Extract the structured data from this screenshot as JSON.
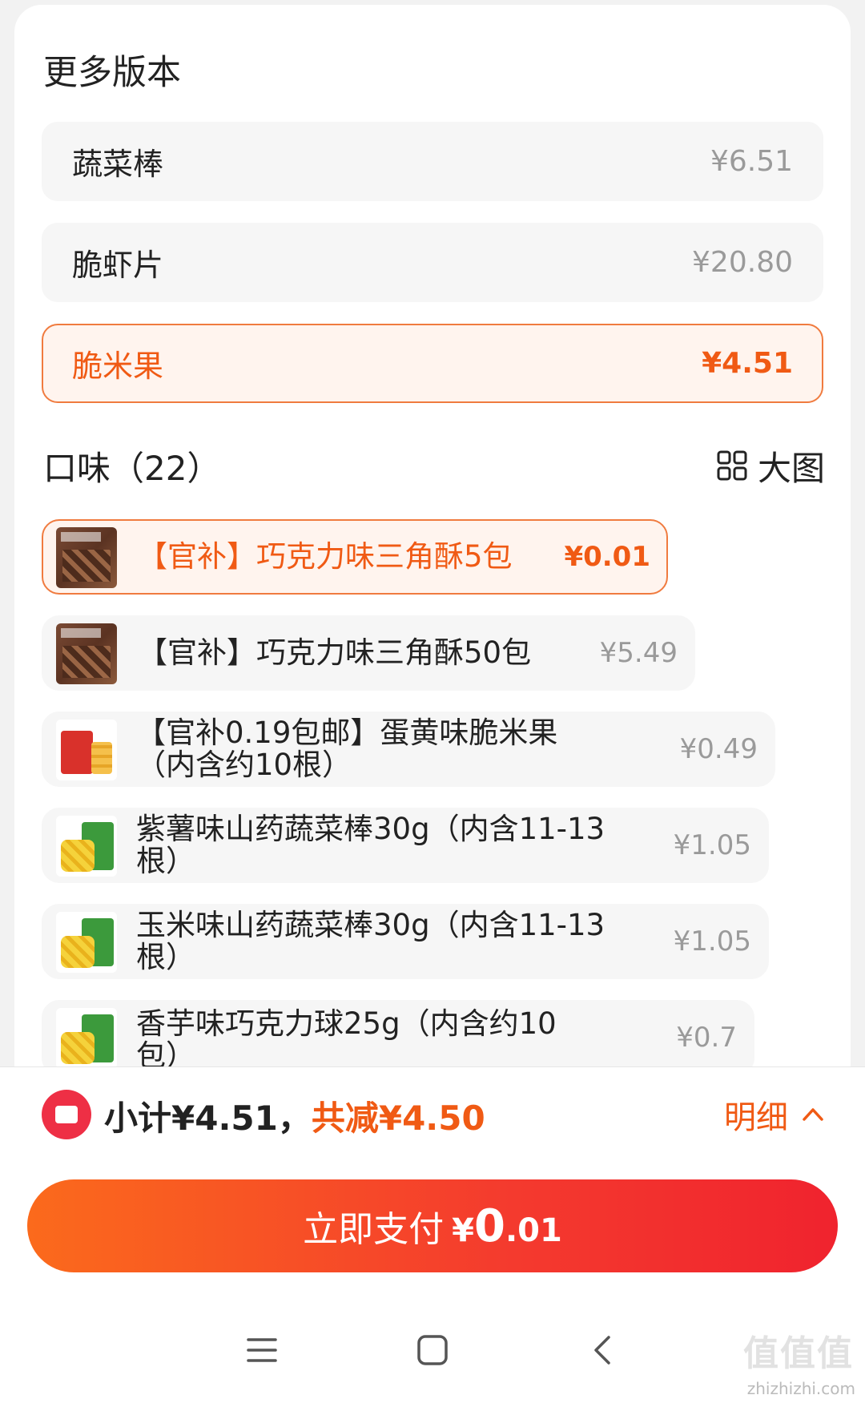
{
  "versions": {
    "title": "更多版本",
    "items": [
      {
        "name": "蔬菜棒",
        "price": "¥6.51"
      },
      {
        "name": "脆虾片",
        "price": "¥20.80"
      },
      {
        "name": "脆米果",
        "price": "¥4.51"
      }
    ]
  },
  "flavors": {
    "title": "口味（22）",
    "big_view_label": "大图",
    "items": [
      {
        "name": "【官补】巧克力味三角酥5包",
        "price": "¥0.01"
      },
      {
        "name": "【官补】巧克力味三角酥50包",
        "price": "¥5.49"
      },
      {
        "name": "【官补0.19包邮】蛋黄味脆米果（内含约10根）",
        "price": "¥0.49"
      },
      {
        "name": "紫薯味山药蔬菜棒30g（内含11-13根）",
        "price": "¥1.05"
      },
      {
        "name": "玉米味山药蔬菜棒30g（内含11-13根）",
        "price": "¥1.05"
      },
      {
        "name": "香芋味巧克力球25g（内含约10包）",
        "price": "¥0.7"
      }
    ]
  },
  "summary": {
    "subtotal": "小计¥4.51，",
    "reduction": "共减¥4.50",
    "detail_label": "明细"
  },
  "pay_button": {
    "label": "立即支付",
    "currency": "¥",
    "amount_int": "0",
    "amount_dec": ".01"
  },
  "watermark": {
    "text": "zhizhizhi.com",
    "logo": "值值值"
  },
  "colors": {
    "accent": "#f05a14",
    "selected_bg": "#fff4ee",
    "pay_gradient_start": "#fb6a1c",
    "pay_gradient_end": "#f0232e",
    "coupon_red": "#ee2f45"
  }
}
